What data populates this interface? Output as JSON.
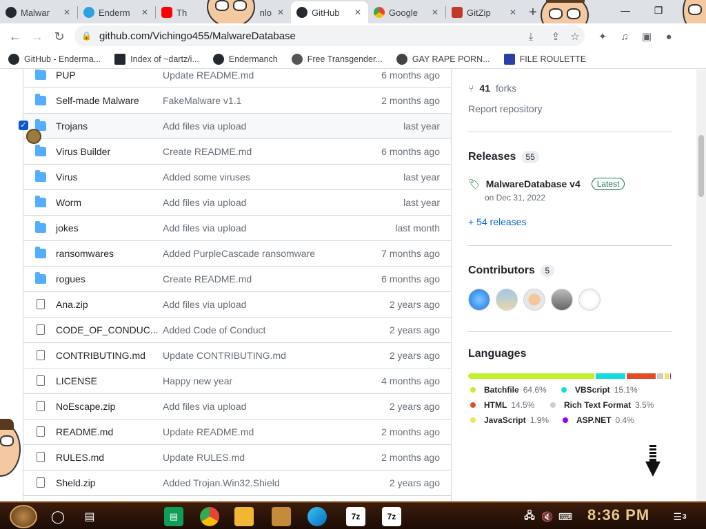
{
  "browser": {
    "tabs": [
      {
        "title": "Malwar",
        "icon": "github-icon",
        "color": "#24292f"
      },
      {
        "title": "Enderm",
        "icon": "telegram-icon",
        "color": "#2aa3de"
      },
      {
        "title": "Th",
        "icon": "youtube-icon",
        "color": "#ff0000"
      },
      {
        "title": "nlo",
        "icon": "generic-icon",
        "color": "#8ab4f8"
      },
      {
        "title": "GitHub",
        "icon": "github-icon",
        "color": "#24292f",
        "active": true
      },
      {
        "title": "Google",
        "icon": "chrome-icon",
        "color": "#4285f4"
      },
      {
        "title": "GitZip",
        "icon": "gitzip-icon",
        "color": "#c0392b"
      }
    ],
    "url": "github.com/Vichingo455/MalwareDatabase",
    "bookmarks": [
      "GitHub - Enderma...",
      "Index of ~dartz/i...",
      "Endermanch",
      "Free Transgender...",
      "GAY RAPE PORN...",
      "FILE ROULETTE"
    ]
  },
  "files": [
    {
      "name": "PUP",
      "message": "Update README.md",
      "time": "6 months ago",
      "type": "folder"
    },
    {
      "name": "Self-made Malware",
      "message": "FakeMalware v1.1",
      "time": "2 months ago",
      "type": "folder"
    },
    {
      "name": "Trojans",
      "message": "Add files via upload",
      "time": "last year",
      "type": "folder"
    },
    {
      "name": "Virus Builder",
      "message": "Create README.md",
      "time": "6 months ago",
      "type": "folder"
    },
    {
      "name": "Virus",
      "message": "Added some viruses",
      "time": "last year",
      "type": "folder"
    },
    {
      "name": "Worm",
      "message": "Add files via upload",
      "time": "last year",
      "type": "folder"
    },
    {
      "name": "jokes",
      "message": "Add files via upload",
      "time": "last month",
      "type": "folder"
    },
    {
      "name": "ransomwares",
      "message": "Added PurpleCascade ransomware",
      "time": "7 months ago",
      "type": "folder"
    },
    {
      "name": "rogues",
      "message": "Create README.md",
      "time": "6 months ago",
      "type": "folder"
    },
    {
      "name": "Ana.zip",
      "message": "Add files via upload",
      "time": "2 years ago",
      "type": "file"
    },
    {
      "name": "CODE_OF_CONDUC...",
      "message": "Added Code of Conduct",
      "time": "2 years ago",
      "type": "file"
    },
    {
      "name": "CONTRIBUTING.md",
      "message": "Update CONTRIBUTING.md",
      "time": "2 years ago",
      "type": "file"
    },
    {
      "name": "LICENSE",
      "message": "Happy new year",
      "time": "4 months ago",
      "type": "file"
    },
    {
      "name": "NoEscape.zip",
      "message": "Add files via upload",
      "time": "2 years ago",
      "type": "file"
    },
    {
      "name": "README.md",
      "message": "Update README.md",
      "time": "2 months ago",
      "type": "file"
    },
    {
      "name": "RULES.md",
      "message": "Update RULES.md",
      "time": "2 months ago",
      "type": "file"
    },
    {
      "name": "Sheld.zip",
      "message": "Added Trojan.Win32.Shield",
      "time": "2 years ago",
      "type": "file"
    }
  ],
  "sidebar": {
    "forks_count": "41",
    "forks_label": "forks",
    "report": "Report repository",
    "releases_title": "Releases",
    "releases_count": "55",
    "latest_release": "MalwareDatabase v4",
    "latest_badge": "Latest",
    "release_date": "on Dec 31, 2022",
    "more_releases": "+ 54 releases",
    "contributors_title": "Contributors",
    "contributors_count": "5",
    "languages_title": "Languages",
    "languages": [
      {
        "name": "Batchfile",
        "percent": "64.6%",
        "value": 64.6,
        "color": "#c1f12e"
      },
      {
        "name": "VBScript",
        "percent": "15.1%",
        "value": 15.1,
        "color": "#15dcdc"
      },
      {
        "name": "HTML",
        "percent": "14.5%",
        "value": 14.5,
        "color": "#e34c26"
      },
      {
        "name": "Rich Text Format",
        "percent": "3.5%",
        "value": 3.5,
        "color": "#cccccc"
      },
      {
        "name": "JavaScript",
        "percent": "1.9%",
        "value": 1.9,
        "color": "#f1e05a"
      },
      {
        "name": "ASP.NET",
        "percent": "0.4%",
        "value": 0.4,
        "color": "#9400ff"
      }
    ]
  },
  "taskbar": {
    "clock": "8:36 PM",
    "apps": [
      "7z",
      "7z"
    ],
    "notification_count": "3"
  }
}
